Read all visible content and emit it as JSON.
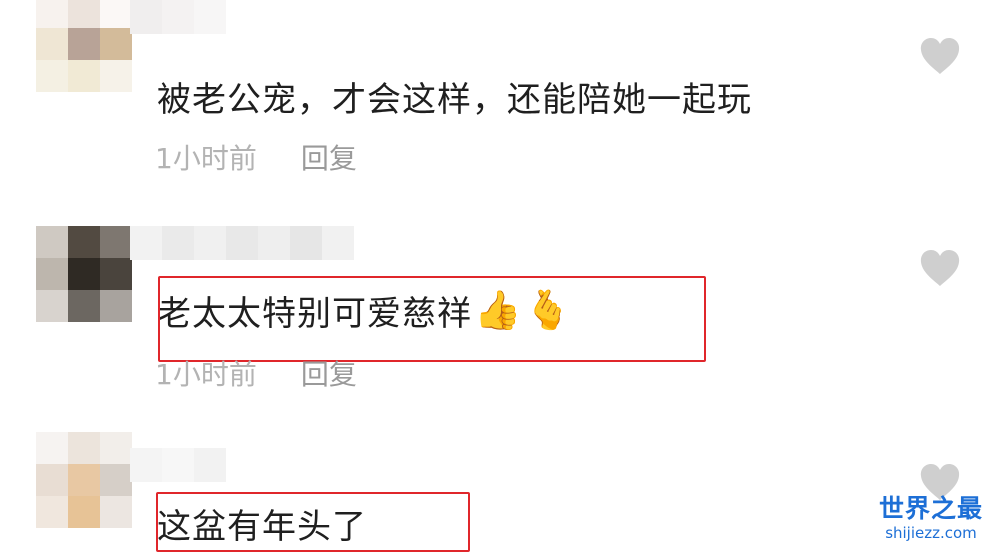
{
  "comments": [
    {
      "text": "被老公宠，才会这样，还能陪她一起玩",
      "time": "1小时前",
      "reply_label": "回复",
      "like_icon": "heart-icon"
    },
    {
      "text": "老太太特别可爱慈祥",
      "emojis": [
        "👍",
        "🫰"
      ],
      "time": "1小时前",
      "reply_label": "回复",
      "like_icon": "heart-icon",
      "highlighted": true
    },
    {
      "text": "这盆有年头了",
      "like_icon": "heart-icon",
      "highlighted": true
    }
  ],
  "watermark": {
    "title": "世界之最",
    "url": "shijiezz.com"
  },
  "colors": {
    "highlight_border": "#e0262b",
    "like_heart": "#cfcfcf",
    "watermark": "#1d6fd6"
  }
}
